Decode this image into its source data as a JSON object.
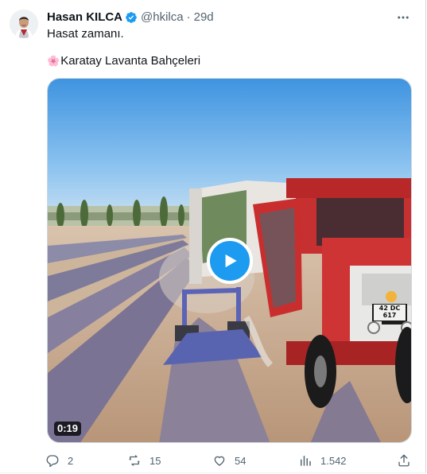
{
  "colors": {
    "accent": "#1d9bf0",
    "muted": "#536471",
    "text": "#0f1419"
  },
  "author": {
    "name": "Hasan KILCA",
    "handle": "@hkilca",
    "separator": "·",
    "time": "29d",
    "verified": true
  },
  "tweet": {
    "line1": "Hasat zamanı.",
    "flower": "🌸",
    "line2": "Karatay Lavanta Bahçeleri"
  },
  "media": {
    "type": "video",
    "duration": "0:19",
    "plate_top": "42 DC",
    "plate_bottom": "617"
  },
  "actions": {
    "replies": "2",
    "reposts": "15",
    "likes": "54",
    "views": "1.542"
  },
  "icons": [
    "more-icon",
    "verified-badge-icon",
    "play-icon",
    "reply-icon",
    "repost-icon",
    "like-icon",
    "views-icon",
    "share-icon"
  ]
}
